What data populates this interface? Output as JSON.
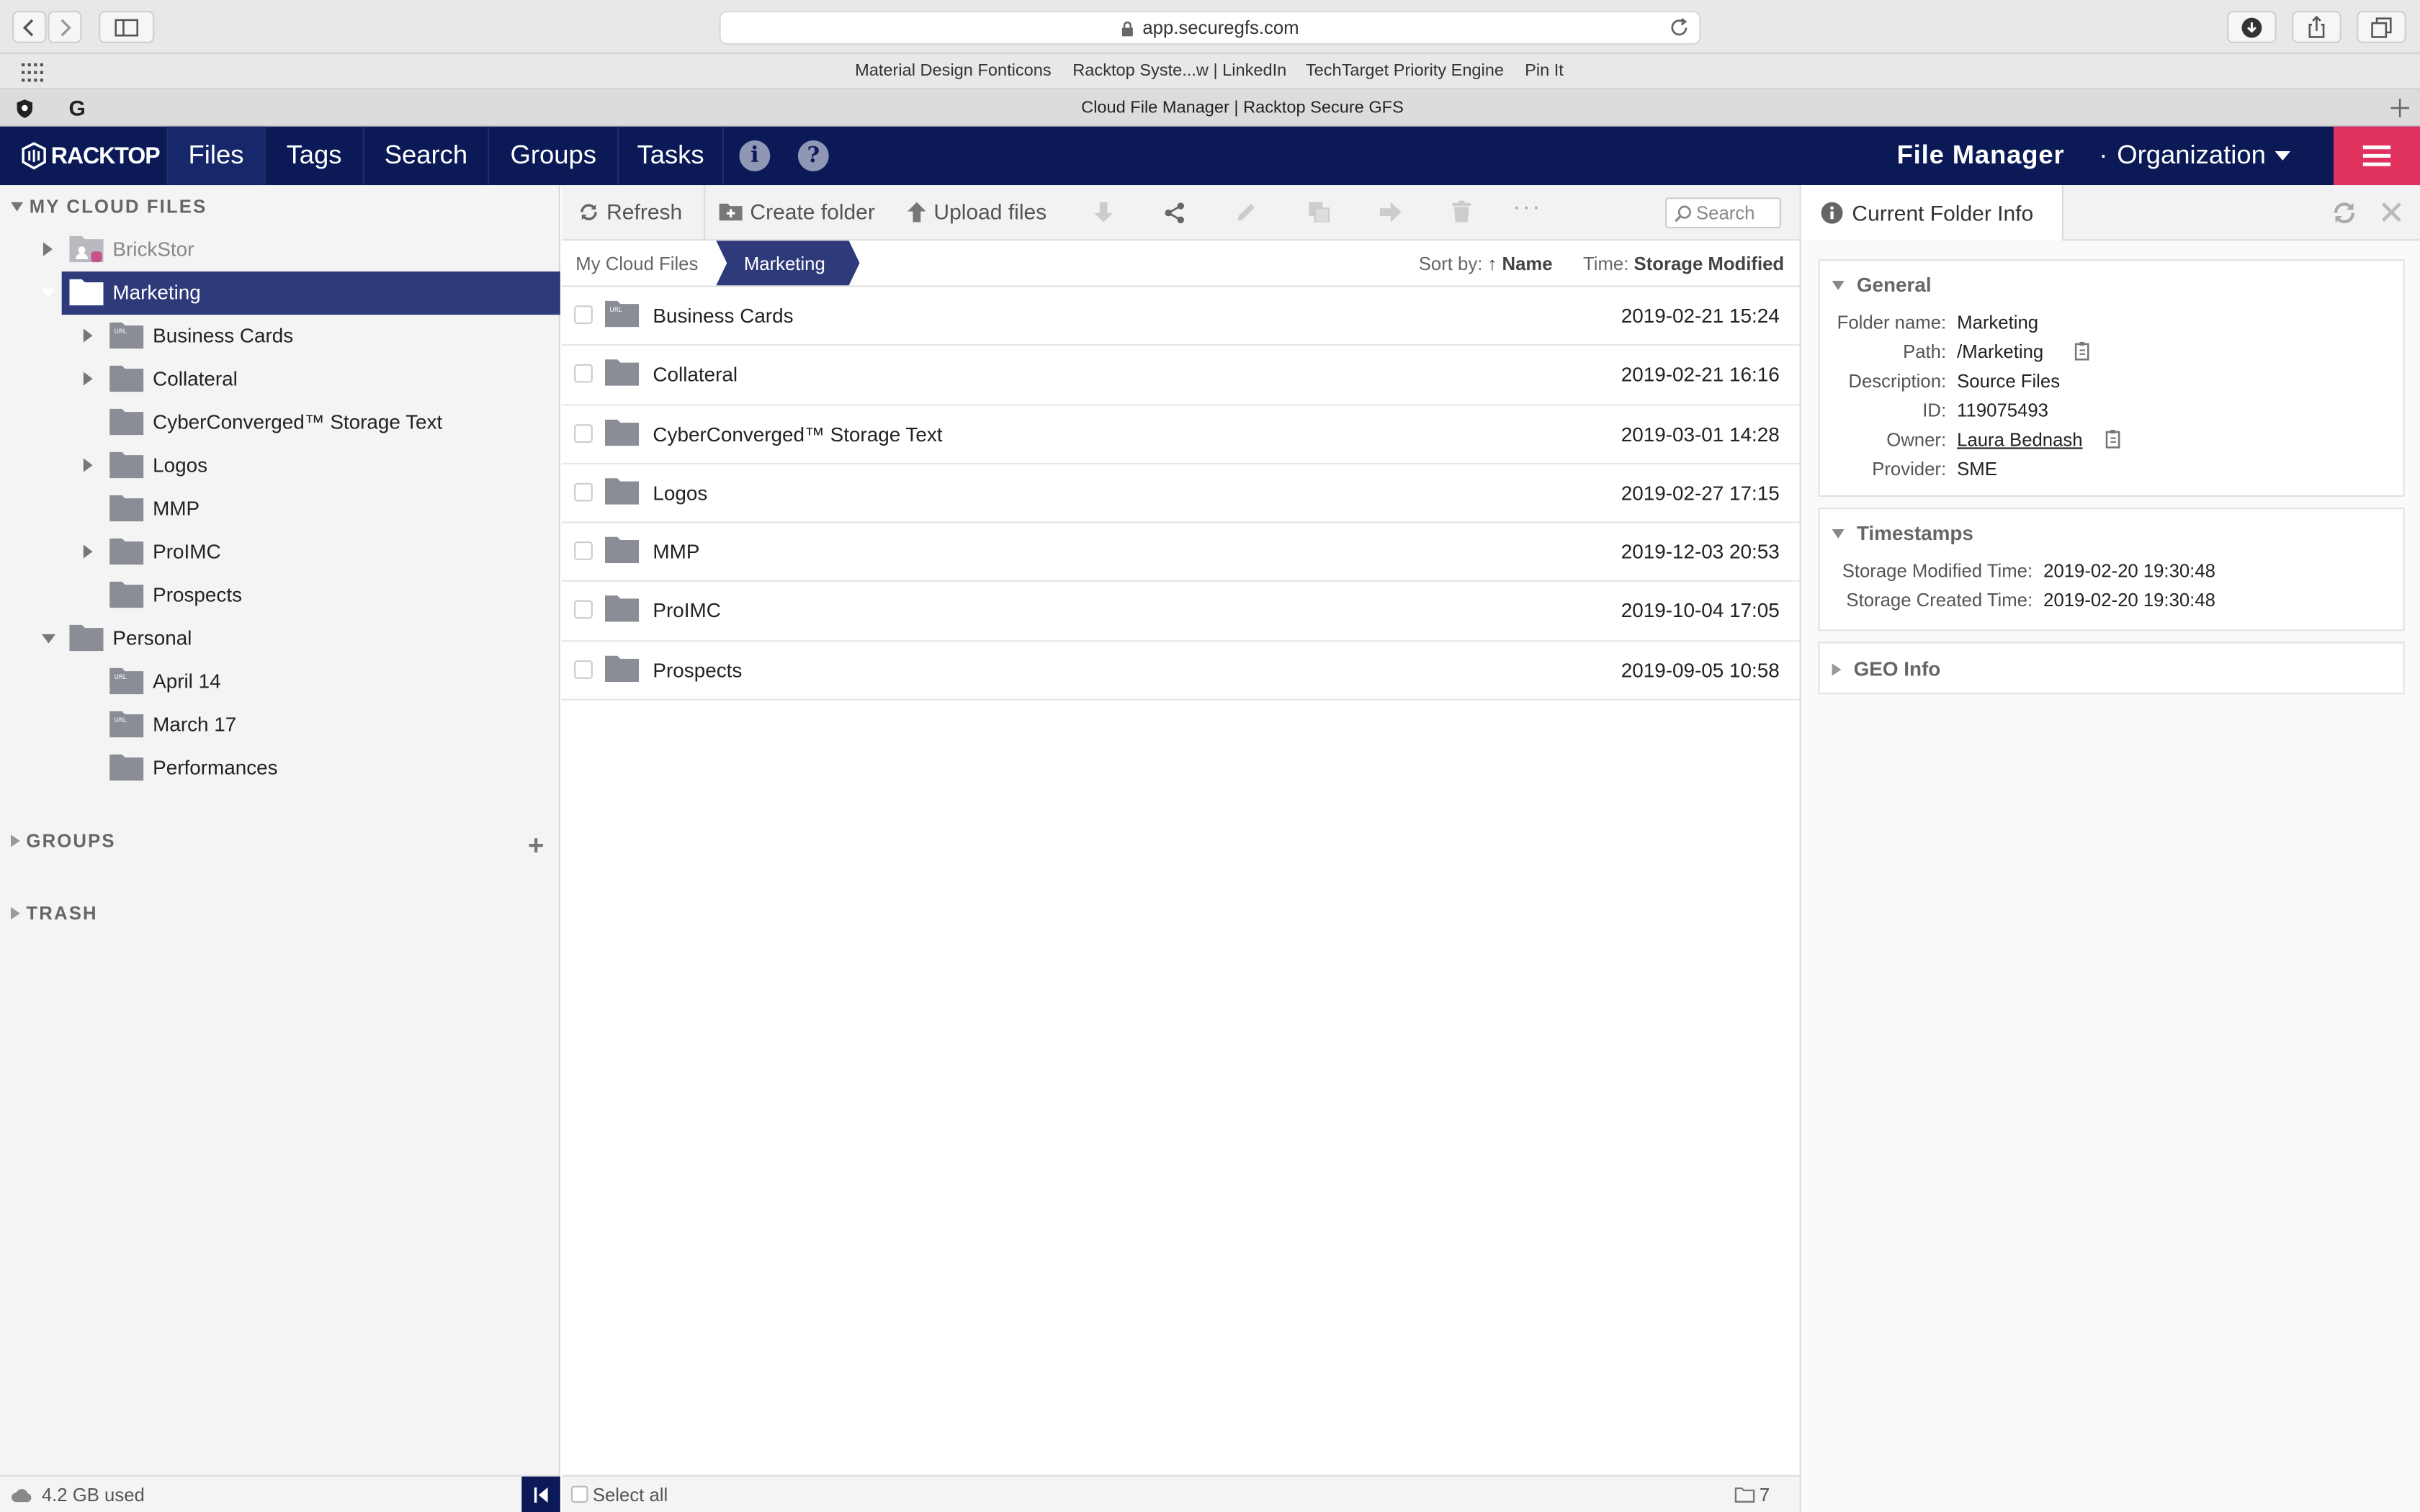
{
  "browser": {
    "url": "app.securegfs.com",
    "bookmarks": [
      "Material Design Fonticons",
      "Racktop Syste...w | LinkedIn",
      "TechTarget Priority Engine",
      "Pin It"
    ],
    "tab_title": "Cloud File Manager | Racktop Secure GFS",
    "pinned_tab_g": "G"
  },
  "nav": {
    "logo": "RACKTOP",
    "items": [
      "Files",
      "Tags",
      "Search",
      "Groups",
      "Tasks"
    ],
    "active": "Files",
    "title": "File Manager",
    "separator": "·",
    "org": "Organization"
  },
  "sidebar": {
    "my_cloud_files": "MY CLOUD FILES",
    "tree": [
      {
        "label": "BrickStor"
      },
      {
        "label": "Marketing"
      },
      {
        "label": "Business Cards"
      },
      {
        "label": "Collateral"
      },
      {
        "label": "CyberConverged™ Storage Text"
      },
      {
        "label": "Logos"
      },
      {
        "label": "MMP"
      },
      {
        "label": "ProIMC"
      },
      {
        "label": "Prospects"
      },
      {
        "label": "Personal"
      },
      {
        "label": "April 14"
      },
      {
        "label": "March 17"
      },
      {
        "label": "Performances"
      }
    ],
    "groups": "GROUPS",
    "trash": "TRASH",
    "usage": "4.2 GB used"
  },
  "toolbar": {
    "refresh": "Refresh",
    "create_folder": "Create folder",
    "upload_files": "Upload files",
    "more": "···",
    "search_placeholder": "Search"
  },
  "breadcrumb": {
    "root": "My Cloud Files",
    "current": "Marketing",
    "sort_label": "Sort by:",
    "sort_value": "↑ Name",
    "time_label": "Time:",
    "time_value": "Storage Modified"
  },
  "files": [
    {
      "name": "Business Cards",
      "date": "2019-02-21 15:24"
    },
    {
      "name": "Collateral",
      "date": "2019-02-21 16:16"
    },
    {
      "name": "CyberConverged™ Storage Text",
      "date": "2019-03-01 14:28"
    },
    {
      "name": "Logos",
      "date": "2019-02-27 17:15"
    },
    {
      "name": "MMP",
      "date": "2019-12-03 20:53"
    },
    {
      "name": "ProIMC",
      "date": "2019-10-04 17:05"
    },
    {
      "name": "Prospects",
      "date": "2019-09-05 10:58"
    }
  ],
  "footer": {
    "select_all": "Select all",
    "count": "7"
  },
  "info_panel": {
    "tab": "Current Folder Info",
    "general": {
      "title": "General",
      "folder_name_k": "Folder name:",
      "folder_name_v": "Marketing",
      "path_k": "Path:",
      "path_v": "/Marketing",
      "description_k": "Description:",
      "description_v": "Source Files",
      "id_k": "ID:",
      "id_v": "119075493",
      "owner_k": "Owner:",
      "owner_v": "Laura Bednash",
      "provider_k": "Provider:",
      "provider_v": "SME"
    },
    "timestamps": {
      "title": "Timestamps",
      "modified_k": "Storage Modified Time:",
      "modified_v": "2019-02-20 19:30:48",
      "created_k": "Storage Created Time:",
      "created_v": "2019-02-20 19:30:48"
    },
    "geo": {
      "title": "GEO Info"
    }
  },
  "colors": {
    "nav_bg": "#0b1a57",
    "accent_pink": "#e0315f",
    "selected_row": "#2f3a7a",
    "folder_gray": "#8a8d96"
  }
}
